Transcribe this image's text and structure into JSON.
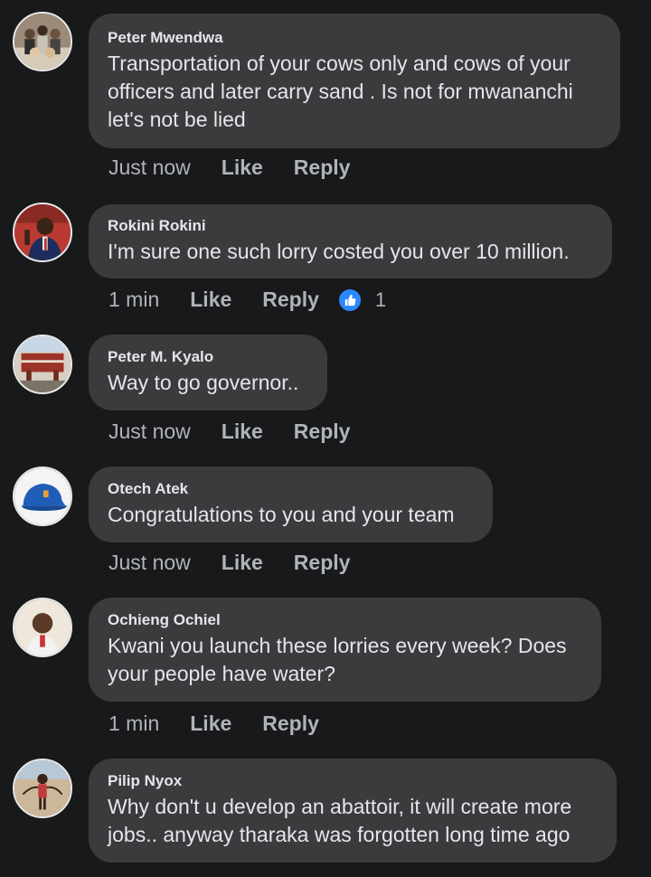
{
  "comments": [
    {
      "author": "Peter Mwendwa",
      "text": "Transportation of your cows only and cows of your officers and later carry sand . Is not for mwananchi let's not be lied",
      "time": "Just now",
      "like_label": "Like",
      "reply_label": "Reply"
    },
    {
      "author": "Rokini Rokini",
      "text": "I'm sure one such lorry costed you over 10 million.",
      "time": "1 min",
      "like_label": "Like",
      "reply_label": "Reply",
      "reaction_count": "1"
    },
    {
      "author": "Peter M. Kyalo",
      "text": "Way to go governor..",
      "time": "Just now",
      "like_label": "Like",
      "reply_label": "Reply"
    },
    {
      "author": "Otech Atek",
      "text": "Congratulations to you and your team",
      "time": "Just now",
      "like_label": "Like",
      "reply_label": "Reply"
    },
    {
      "author": "Ochieng Ochiel",
      "text": "Kwani you launch these lorries every week? Does your people have water?",
      "time": "1 min",
      "like_label": "Like",
      "reply_label": "Reply"
    },
    {
      "author": "Pilip Nyox",
      "text": "Why don't u develop an abattoir, it will create more jobs.. anyway tharaka was forgotten long time ago"
    }
  ],
  "colors": {
    "background": "#18191a",
    "bubble": "#3a3b3c",
    "text": "#e4e6eb",
    "secondary": "#b0b3b8",
    "like_badge": "#2d88ff"
  },
  "icons": {
    "reaction": "thumbs-up-icon"
  }
}
